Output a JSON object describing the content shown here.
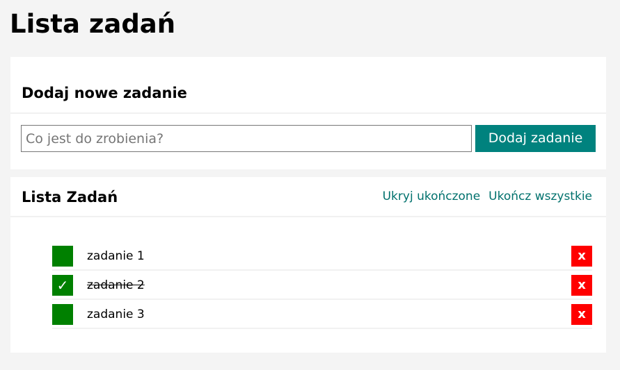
{
  "page": {
    "title": "Lista zadań"
  },
  "add_section": {
    "title": "Dodaj nowe zadanie",
    "input_value": "",
    "input_placeholder": "Co jest do zrobienia?",
    "button_label": "Dodaj zadanie"
  },
  "list_section": {
    "title": "Lista Zadań",
    "hide_completed_label": "Ukryj ukończone",
    "complete_all_label": "Ukończ wszystkie",
    "tasks": [
      {
        "label": "zadanie 1",
        "done": false,
        "check_glyph": "",
        "delete_glyph": "x"
      },
      {
        "label": "zadanie 2",
        "done": true,
        "check_glyph": "✓",
        "delete_glyph": "x"
      },
      {
        "label": "zadanie 3",
        "done": false,
        "check_glyph": "",
        "delete_glyph": "x"
      }
    ]
  },
  "colors": {
    "accent": "#00827e",
    "link": "#00716d",
    "checkbox": "#008000",
    "delete": "#ff0000",
    "background": "#f4f4f4"
  },
  "icons": {
    "checkbox": "checkmark-icon",
    "delete": "close-icon"
  }
}
